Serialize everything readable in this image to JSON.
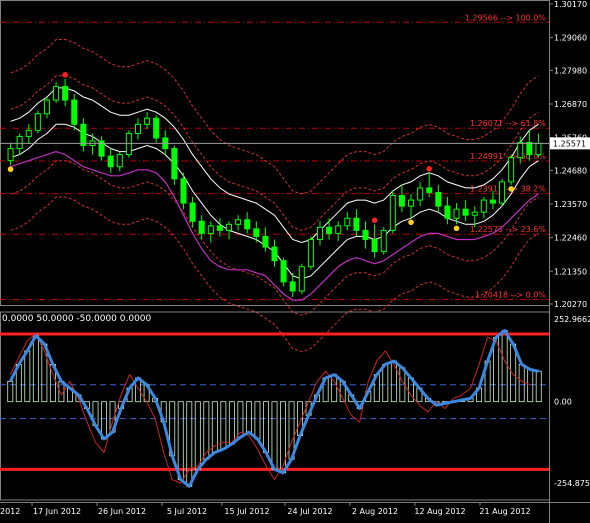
{
  "colors": {
    "background": "#000000",
    "grid_border": "#808080",
    "text": "#ffffff",
    "candle": "#00ff00",
    "ma_white": "#ffffff",
    "fib_line": "#c00000",
    "fib_label": "#ff3030",
    "envelope_red": "#c83232",
    "magenta": "#c030c0",
    "cci_blue": "#3a88e0",
    "cci_red": "#cc2222",
    "cci_level": "#ff2020",
    "cci_dash": "#4060d0",
    "dot_red": "#ff2020",
    "dot_yellow": "#ffd020"
  },
  "indicator_header": "0.0000 50.0000 -50.0000 0.0000",
  "chart_data": [
    {
      "type": "line",
      "name": "price",
      "ylim": [
        1.2027,
        1.3017
      ],
      "price_ticks": [
        "1.30170",
        "1.29060",
        "1.27980",
        "1.26870",
        "1.25760",
        "1.24680",
        "1.23570",
        "1.22460",
        "1.21350",
        "1.20270"
      ],
      "current_price": "1.25571",
      "x_labels": [
        "17 Jun 2012",
        "26 Jun 2012",
        "5 Jul 2012",
        "15 Jul 2012",
        "24 Jul 2012",
        "2 Aug 2012",
        "12 Aug 2012",
        "21 Aug 2012"
      ],
      "x_label_partial": "2012",
      "fib_levels": [
        {
          "price": 1.29566,
          "label": "1.29566 --> 100.0%"
        },
        {
          "price": 1.26071,
          "label": "1.26071 --> 61.8%"
        },
        {
          "price": 1.24991,
          "label": "1.24991 --> 50.0%"
        },
        {
          "price": 1.23911,
          "label": "1.23911 --> 38.2%"
        },
        {
          "price": 1.22573,
          "label": "1.22573 --> 23.6%"
        },
        {
          "price": 1.20418,
          "label": "1.20418 --> 0.0%"
        }
      ],
      "candles": [
        [
          1.25,
          1.256,
          1.2485,
          1.254
        ],
        [
          1.254,
          1.259,
          1.252,
          1.258
        ],
        [
          1.258,
          1.262,
          1.2555,
          1.26
        ],
        [
          1.26,
          1.2665,
          1.259,
          1.2655
        ],
        [
          1.2655,
          1.271,
          1.264,
          1.27
        ],
        [
          1.27,
          1.276,
          1.269,
          1.2745
        ],
        [
          1.2745,
          1.277,
          1.268,
          1.27
        ],
        [
          1.27,
          1.272,
          1.26,
          1.262
        ],
        [
          1.262,
          1.264,
          1.253,
          1.255
        ],
        [
          1.255,
          1.259,
          1.252,
          1.2565
        ],
        [
          1.2565,
          1.258,
          1.25,
          1.2515
        ],
        [
          1.2515,
          1.254,
          1.246,
          1.248
        ],
        [
          1.248,
          1.253,
          1.2465,
          1.252
        ],
        [
          1.252,
          1.26,
          1.251,
          1.259
        ],
        [
          1.259,
          1.264,
          1.257,
          1.262
        ],
        [
          1.262,
          1.266,
          1.2605,
          1.264
        ],
        [
          1.264,
          1.265,
          1.256,
          1.2575
        ],
        [
          1.2575,
          1.26,
          1.252,
          1.254
        ],
        [
          1.254,
          1.255,
          1.242,
          1.244
        ],
        [
          1.244,
          1.246,
          1.234,
          1.236
        ],
        [
          1.236,
          1.238,
          1.228,
          1.23
        ],
        [
          1.23,
          1.232,
          1.224,
          1.226
        ],
        [
          1.226,
          1.23,
          1.223,
          1.2285
        ],
        [
          1.2285,
          1.231,
          1.225,
          1.227
        ],
        [
          1.227,
          1.23,
          1.224,
          1.229
        ],
        [
          1.229,
          1.232,
          1.227,
          1.2305
        ],
        [
          1.2305,
          1.233,
          1.226,
          1.2275
        ],
        [
          1.2275,
          1.23,
          1.223,
          1.225
        ],
        [
          1.225,
          1.228,
          1.22,
          1.2215
        ],
        [
          1.2215,
          1.224,
          1.215,
          1.217
        ],
        [
          1.217,
          1.218,
          1.2085,
          1.21
        ],
        [
          1.21,
          1.213,
          1.205,
          1.207
        ],
        [
          1.207,
          1.216,
          1.206,
          1.215
        ],
        [
          1.215,
          1.225,
          1.214,
          1.224
        ],
        [
          1.224,
          1.23,
          1.222,
          1.228
        ],
        [
          1.228,
          1.231,
          1.224,
          1.226
        ],
        [
          1.226,
          1.23,
          1.2235,
          1.2285
        ],
        [
          1.2285,
          1.233,
          1.227,
          1.231
        ],
        [
          1.231,
          1.234,
          1.225,
          1.227
        ],
        [
          1.227,
          1.23,
          1.221,
          1.224
        ],
        [
          1.224,
          1.229,
          1.218,
          1.22
        ],
        [
          1.22,
          1.228,
          1.219,
          1.227
        ],
        [
          1.227,
          1.24,
          1.226,
          1.2385
        ],
        [
          1.2385,
          1.242,
          1.233,
          1.235
        ],
        [
          1.235,
          1.239,
          1.231,
          1.237
        ],
        [
          1.237,
          1.243,
          1.235,
          1.241
        ],
        [
          1.241,
          1.246,
          1.238,
          1.2395
        ],
        [
          1.2395,
          1.242,
          1.233,
          1.235
        ],
        [
          1.235,
          1.238,
          1.229,
          1.231
        ],
        [
          1.231,
          1.236,
          1.229,
          1.234
        ],
        [
          1.234,
          1.237,
          1.23,
          1.232
        ],
        [
          1.232,
          1.235,
          1.228,
          1.233
        ],
        [
          1.233,
          1.238,
          1.231,
          1.237
        ],
        [
          1.237,
          1.24,
          1.234,
          1.236
        ],
        [
          1.236,
          1.244,
          1.235,
          1.243
        ],
        [
          1.243,
          1.252,
          1.242,
          1.251
        ],
        [
          1.251,
          1.258,
          1.249,
          1.256
        ],
        [
          1.256,
          1.26,
          1.25,
          1.252
        ],
        [
          1.252,
          1.259,
          1.251,
          1.2557
        ]
      ],
      "series": [
        {
          "name": "ma_white",
          "values": [
            1.255,
            1.256,
            1.258,
            1.261,
            1.263,
            1.266,
            1.266,
            1.265,
            1.263,
            1.262,
            1.26,
            1.258,
            1.257,
            1.257,
            1.258,
            1.259,
            1.258,
            1.256,
            1.253,
            1.249,
            1.244,
            1.24,
            1.236,
            1.233,
            1.231,
            1.23,
            1.229,
            1.228,
            1.226,
            1.224,
            1.22,
            1.216,
            1.215,
            1.216,
            1.219,
            1.222,
            1.225,
            1.228,
            1.229,
            1.229,
            1.228,
            1.229,
            1.232,
            1.234,
            1.235,
            1.237,
            1.238,
            1.237,
            1.235,
            1.234,
            1.233,
            1.233,
            1.234,
            1.236,
            1.239,
            1.243,
            1.248,
            1.252,
            1.254
          ]
        },
        {
          "name": "magenta",
          "values": [
            1.248,
            1.249,
            1.25,
            1.251,
            1.252,
            1.253,
            1.252,
            1.25,
            1.248,
            1.247,
            1.246,
            1.245,
            1.245,
            1.246,
            1.247,
            1.247,
            1.246,
            1.243,
            1.238,
            1.232,
            1.226,
            1.221,
            1.217,
            1.215,
            1.214,
            1.214,
            1.214,
            1.213,
            1.212,
            1.209,
            1.206,
            1.204,
            1.204,
            1.206,
            1.209,
            1.212,
            1.215,
            1.217,
            1.218,
            1.217,
            1.216,
            1.217,
            1.219,
            1.221,
            1.223,
            1.225,
            1.226,
            1.226,
            1.225,
            1.224,
            1.224,
            1.224,
            1.225,
            1.226,
            1.228,
            1.231,
            1.234,
            1.237,
            1.239
          ]
        }
      ]
    },
    {
      "type": "line",
      "name": "cci",
      "ylim": [
        -254.8759,
        252.9662
      ],
      "y_ticks": [
        "252.9662",
        "0.00",
        "-254.8759"
      ],
      "levels": [
        200,
        50,
        -50,
        -200
      ],
      "series": [
        {
          "name": "cci_blue",
          "values": [
            60,
            110,
            150,
            195,
            170,
            110,
            60,
            40,
            20,
            -20,
            -70,
            -110,
            -90,
            -20,
            40,
            70,
            50,
            10,
            -60,
            -160,
            -230,
            -250,
            -200,
            -170,
            -150,
            -140,
            -125,
            -105,
            -90,
            -110,
            -150,
            -200,
            -210,
            -170,
            -100,
            -40,
            20,
            70,
            80,
            60,
            20,
            -20,
            30,
            80,
            110,
            120,
            100,
            70,
            40,
            10,
            -10,
            -5,
            0,
            5,
            10,
            40,
            120,
            190,
            210,
            170,
            110,
            95,
            90
          ]
        },
        {
          "name": "cci_red",
          "values": [
            80,
            130,
            180,
            200,
            150,
            80,
            20,
            60,
            10,
            -60,
            -120,
            -150,
            -60,
            20,
            80,
            40,
            0,
            -50,
            -150,
            -230,
            -240,
            -200,
            -190,
            -150,
            -130,
            -120,
            -120,
            -90,
            -100,
            -140,
            -190,
            -230,
            -190,
            -120,
            -60,
            0,
            60,
            90,
            60,
            10,
            -40,
            -60,
            60,
            120,
            150,
            110,
            60,
            20,
            -10,
            -30,
            0,
            -20,
            10,
            20,
            40,
            110,
            190,
            180,
            120,
            80,
            60,
            50
          ]
        }
      ]
    }
  ]
}
